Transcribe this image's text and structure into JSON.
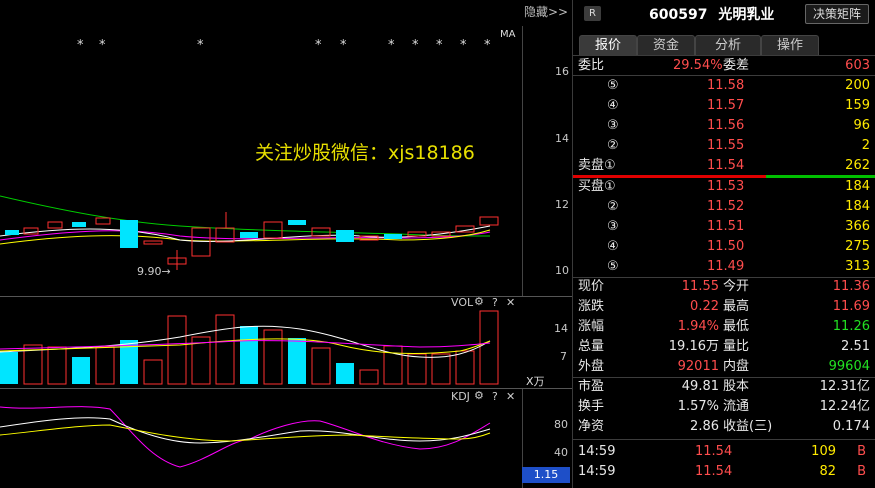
{
  "chart": {
    "hide_label": "隐藏>>",
    "ma_label": "MA",
    "watermark": "关注炒股微信：xjs18186",
    "low_marker": "9.90→",
    "price_ticks": [
      "16",
      "14",
      "12",
      "10"
    ],
    "vol": {
      "label": "VOL",
      "unit": "X万",
      "ticks": [
        "14",
        "7"
      ]
    },
    "kdj": {
      "label": "KDJ",
      "ticks": [
        "80",
        "40"
      ],
      "value": "1.15"
    },
    "icons": {
      "settings": "⚙",
      "help": "?",
      "close": "✕"
    },
    "colors": {
      "up": "#ff3030",
      "down": "#00e5ff",
      "ma5": "#ffffff",
      "ma10": "#ffff00",
      "ma20": "#ff00ff",
      "ma60": "#00cc00"
    }
  },
  "header": {
    "badge": "R",
    "code": "600597",
    "name": "光明乳业",
    "decision_button": "决策矩阵"
  },
  "tabs": [
    "报价",
    "资金",
    "分析",
    "操作"
  ],
  "quote": {
    "commission_ratio": {
      "label": "委比",
      "value": "29.54%"
    },
    "commission_diff": {
      "label": "委差",
      "value": "603"
    },
    "asks": [
      {
        "label": "⑤",
        "price": "11.58",
        "vol": "200"
      },
      {
        "label": "④",
        "price": "11.57",
        "vol": "159"
      },
      {
        "label": "③",
        "price": "11.56",
        "vol": "96"
      },
      {
        "label": "②",
        "price": "11.55",
        "vol": "2"
      },
      {
        "label": "卖盘①",
        "price": "11.54",
        "vol": "262"
      }
    ],
    "bids": [
      {
        "label": "买盘①",
        "price": "11.53",
        "vol": "184"
      },
      {
        "label": "②",
        "price": "11.52",
        "vol": "184"
      },
      {
        "label": "③",
        "price": "11.51",
        "vol": "366"
      },
      {
        "label": "④",
        "price": "11.50",
        "vol": "275"
      },
      {
        "label": "⑤",
        "price": "11.49",
        "vol": "313"
      }
    ],
    "stats": [
      {
        "l1": "现价",
        "v1": "11.55",
        "c1": "red",
        "l2": "今开",
        "v2": "11.36",
        "c2": "red"
      },
      {
        "l1": "涨跌",
        "v1": "0.22",
        "c1": "red",
        "l2": "最高",
        "v2": "11.69",
        "c2": "red"
      },
      {
        "l1": "涨幅",
        "v1": "1.94%",
        "c1": "red",
        "l2": "最低",
        "v2": "11.26",
        "c2": "green"
      },
      {
        "l1": "总量",
        "v1": "19.16万",
        "c1": "white",
        "l2": "量比",
        "v2": "2.51",
        "c2": "white"
      },
      {
        "l1": "外盘",
        "v1": "92011",
        "c1": "red",
        "l2": "内盘",
        "v2": "99604",
        "c2": "green"
      }
    ],
    "fundamentals": [
      {
        "l1": "市盈",
        "v1": "49.81",
        "l2": "股本",
        "v2": "12.31亿"
      },
      {
        "l1": "换手",
        "v1": "1.57%",
        "l2": "流通",
        "v2": "12.24亿"
      },
      {
        "l1": "净资",
        "v1": "2.86",
        "l2": "收益(三)",
        "v2": "0.174"
      }
    ],
    "ticks": [
      {
        "time": "14:59",
        "price": "11.54",
        "vol": "109",
        "side": "B"
      },
      {
        "time": "14:59",
        "price": "11.54",
        "vol": "82",
        "side": "B"
      }
    ]
  }
}
